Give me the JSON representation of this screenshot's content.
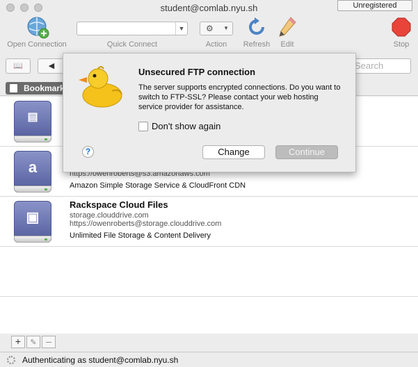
{
  "window": {
    "title": "student@comlab.nyu.sh",
    "badge": "Unregistered"
  },
  "toolbar": {
    "open_connection": "Open Connection",
    "quick_connect": "Quick Connect",
    "quick_connect_value": "",
    "action": "Action",
    "refresh": "Refresh",
    "edit": "Edit",
    "stop": "Stop"
  },
  "navbar": {
    "search_placeholder": "Search"
  },
  "tabs": {
    "bookmarks": "Bookmarks"
  },
  "bookmarks": [
    {
      "title": "",
      "host": "",
      "user": "",
      "description": "",
      "icon": "ftp-drive-icon"
    },
    {
      "title": "",
      "host": "",
      "user": "https://owenroberts@s3.amazonaws.com",
      "description": "Amazon Simple Storage Service & CloudFront CDN",
      "icon": "amazon-drive-icon"
    },
    {
      "title": "Rackspace Cloud Files",
      "host": "storage.clouddrive.com",
      "user": "https://owenroberts@storage.clouddrive.com",
      "description": "Unlimited File Storage & Content Delivery",
      "icon": "rackspace-drive-icon"
    }
  ],
  "status": {
    "text": "Authenticating as student@comlab.nyu.sh"
  },
  "sheet": {
    "title": "Unsecured FTP connection",
    "message": "The server supports encrypted connections. Do you want to switch to FTP-SSL? Please contact your web hosting service provider for assistance.",
    "checkbox_label": "Don't show again",
    "checkbox_checked": false,
    "change_button": "Change",
    "continue_button": "Continue",
    "help": "?"
  },
  "colors": {
    "stop": "#e8443a",
    "accent": "#1f6fd6"
  }
}
